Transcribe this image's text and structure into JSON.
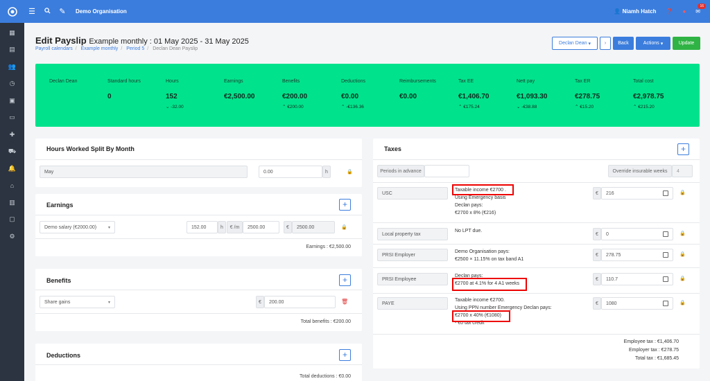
{
  "topbar": {
    "org": "Demo Organisation",
    "user": "Niamh Hatch",
    "notif_count": "16",
    "icons": [
      "menu-icon",
      "search-icon",
      "pen-icon",
      "user-icon",
      "help-icon",
      "bell-icon",
      "mail-icon"
    ]
  },
  "page": {
    "title": "Edit Payslip",
    "subtitle": "Example monthly : 01 May 2025 - 31 May 2025",
    "breadcrumbs": [
      "Payroll calendars",
      "Example monthly",
      "Period 5",
      "Declan Dean Payslip"
    ]
  },
  "header_buttons": {
    "employee": "Declan Dean",
    "back": "Back",
    "actions": "Actions",
    "update": "Update"
  },
  "summary": [
    {
      "label": "Declan Dean",
      "value": "",
      "delta": ""
    },
    {
      "label": "Standard hours",
      "value": "0",
      "delta": ""
    },
    {
      "label": "Hours",
      "value": "152",
      "delta": "-32.00",
      "dir": "down"
    },
    {
      "label": "Earnings",
      "value": "€2,500.00",
      "delta": ""
    },
    {
      "label": "Benefits",
      "value": "€200.00",
      "delta": "€200.00",
      "dir": "up"
    },
    {
      "label": "Deductions",
      "value": "€0.00",
      "delta": "-€136.36",
      "dir": "up"
    },
    {
      "label": "Reimbursements",
      "value": "€0.00",
      "delta": ""
    },
    {
      "label": "Tax EE",
      "value": "€1,406.70",
      "delta": "€175.24",
      "dir": "up"
    },
    {
      "label": "Nett pay",
      "value": "€1,093.30",
      "delta": "-€38.88",
      "dir": "down"
    },
    {
      "label": "Tax ER",
      "value": "€278.75",
      "delta": "€15.20",
      "dir": "up"
    },
    {
      "label": "Total cost",
      "value": "€2,978.75",
      "delta": "€215.20",
      "dir": "up"
    }
  ],
  "hours_split": {
    "title": "Hours Worked Split By Month",
    "month": "May",
    "hours": "0.00",
    "unit": "h"
  },
  "earnings": {
    "title": "Earnings",
    "item": "Demo salary (€2000.00)",
    "hours": "152.00",
    "hours_unit": "h",
    "rate_unit": "€ /m",
    "rate": "2500.00",
    "currency": "€",
    "amount": "2500.00",
    "footer": "Earnings : €2,500.00"
  },
  "benefits": {
    "title": "Benefits",
    "item": "Share gains",
    "currency": "€",
    "amount": "200.00",
    "footer": "Total benefits : €200.00"
  },
  "deductions": {
    "title": "Deductions",
    "footer": "Total deductions : €0.00"
  },
  "taxes": {
    "title": "Taxes",
    "periods_label": "Periods in advance",
    "periods_value": "",
    "override_label": "Override insurable weeks",
    "override_value": "4",
    "currency": "€",
    "rows": [
      {
        "name": "USC",
        "lines": [
          "Taxable income €2700 .",
          "Using Emergency basis",
          "Declan pays:",
          "€2700 x 8% (€216)"
        ],
        "value": "216"
      },
      {
        "name": "Local property tax",
        "lines": [
          "No LPT due."
        ],
        "value": "0"
      },
      {
        "name": "PRSI Employer",
        "lines": [
          "Demo Organisation pays:",
          "€2500 × 11.15% on tax band A1"
        ],
        "value": "278.75"
      },
      {
        "name": "PRSI Employee",
        "lines": [
          "Declan pays:",
          "€2700 at 4.1% for 4 A1 weeks"
        ],
        "value": "110.7"
      },
      {
        "name": "PAYE",
        "lines": [
          "Taxable income €2700.",
          "Using PPN number Emergency Declan pays:",
          "€2700 x 40% (€1080)",
          "- €0 tax credit"
        ],
        "value": "1080"
      }
    ],
    "totals": {
      "employee": "Employee tax : €1,406.70",
      "employer": "Employer tax : €278.75",
      "total": "Total tax : €1,685.45"
    }
  },
  "sidebar_icons": [
    "dashboard-icon",
    "reports-icon",
    "people-icon",
    "clock-icon",
    "briefcase-icon",
    "card-icon",
    "plus-icon",
    "car-icon",
    "bell-icon",
    "bank-icon",
    "chart-icon",
    "document-icon",
    "gear-icon"
  ]
}
